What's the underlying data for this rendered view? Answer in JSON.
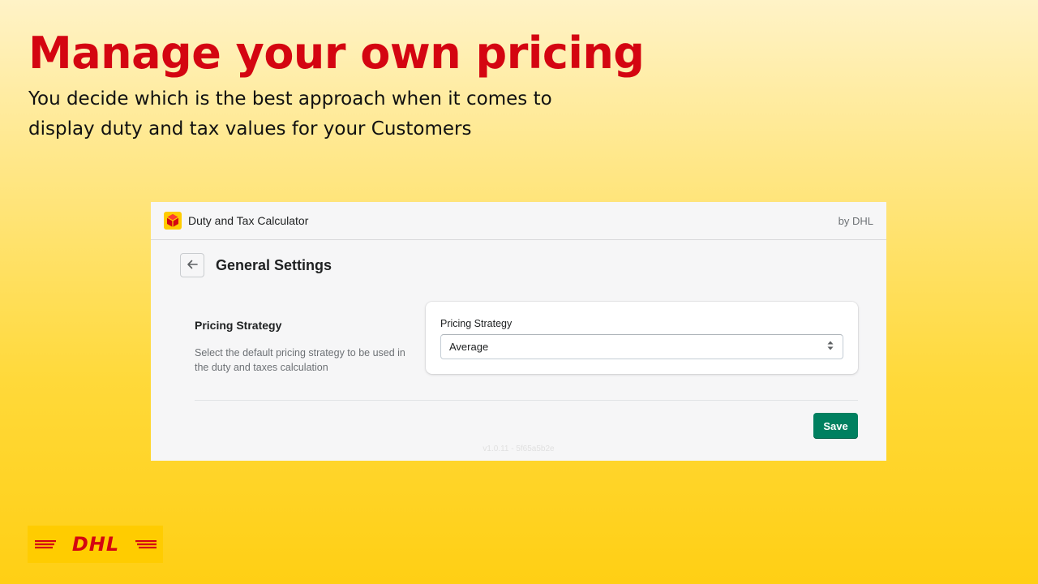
{
  "marketing": {
    "headline": "Manage your own pricing",
    "subline": "You decide which is the best approach when it comes to display duty and tax values for your Customers"
  },
  "app": {
    "title": "Duty and Tax Calculator",
    "byline": "by DHL",
    "logo_icon": "dhl-package-icon"
  },
  "page": {
    "title": "General Settings",
    "back_icon": "arrow-left-icon"
  },
  "section": {
    "title": "Pricing Strategy",
    "description": "Select the default pricing strategy to be used in the duty and taxes calculation"
  },
  "field": {
    "label": "Pricing Strategy",
    "selected_value": "Average",
    "select_icon": "select-arrows-icon"
  },
  "actions": {
    "save_label": "Save"
  },
  "footer": {
    "version": "v1.0.11 - 5f65a5b2e"
  },
  "brand": {
    "logo_text": "DHL",
    "primary_red": "#d40511",
    "yellow": "#ffcc00",
    "save_green": "#008060"
  }
}
